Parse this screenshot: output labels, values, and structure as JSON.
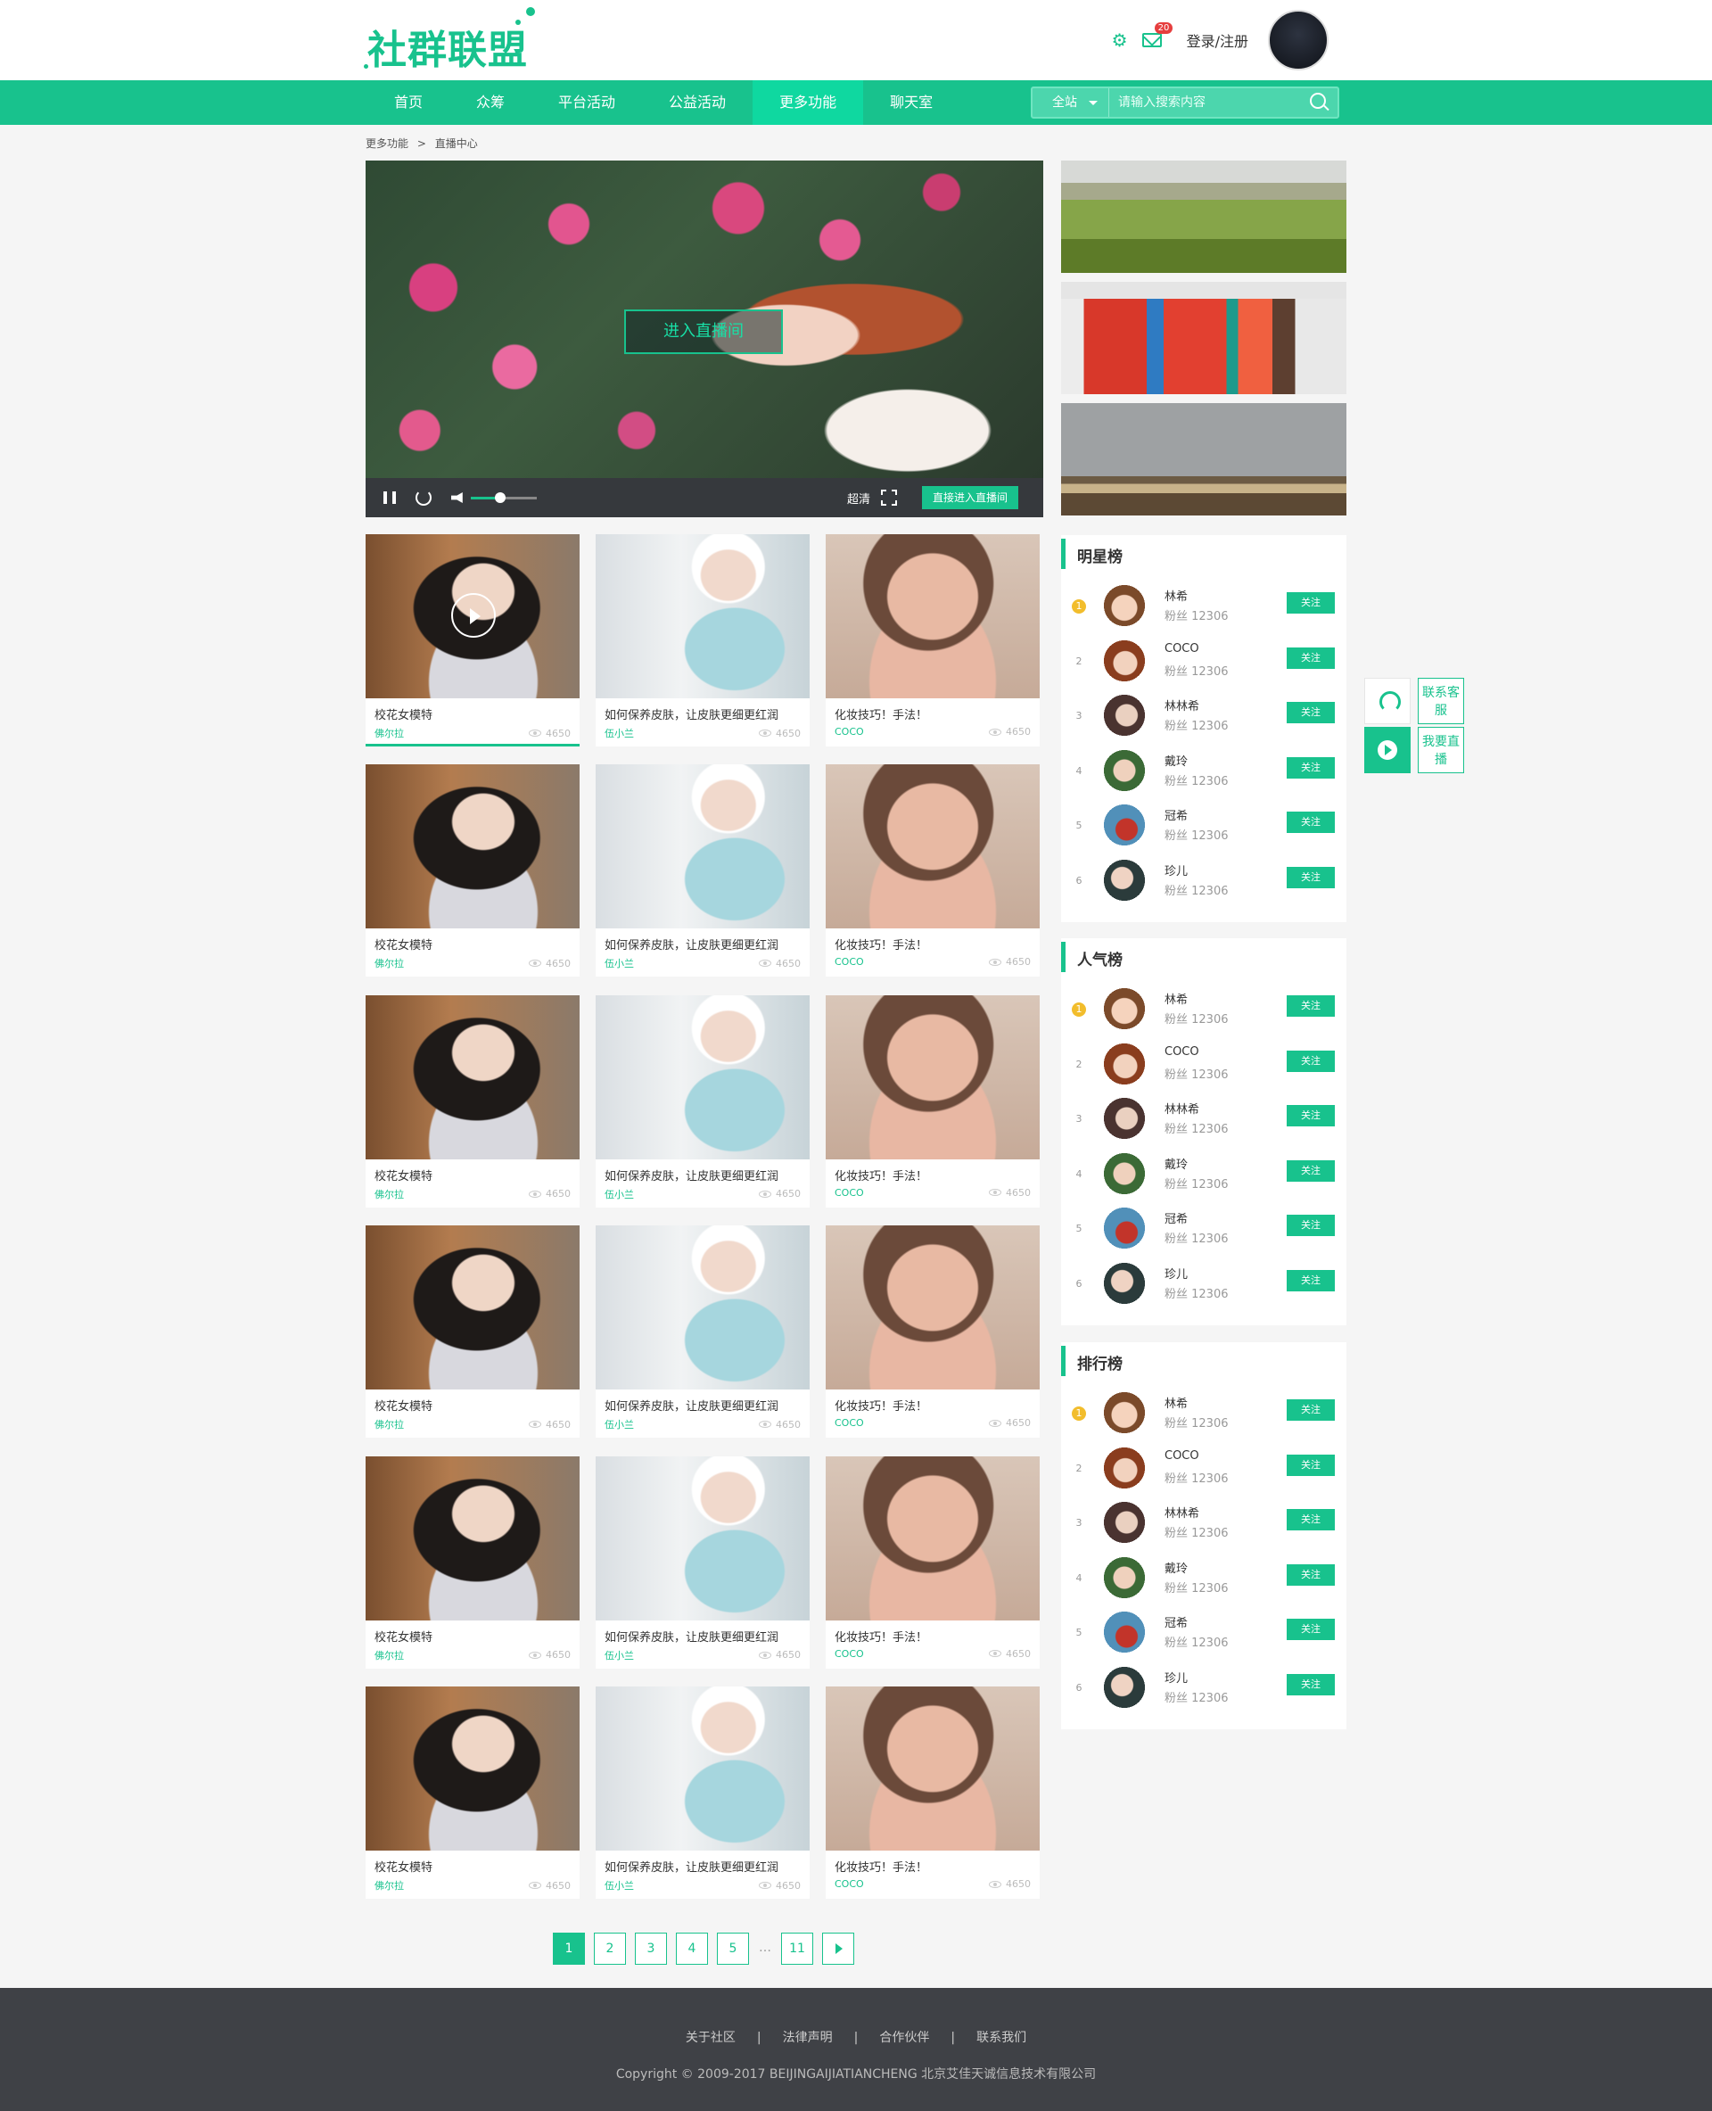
{
  "header": {
    "logo": "社群联盟",
    "mail_badge": "20",
    "login_label": "登录/注册",
    "icons": [
      "gear-icon",
      "mail-icon",
      "user-avatar"
    ]
  },
  "nav": {
    "items": [
      "首页",
      "众筹",
      "平台活动",
      "公益活动",
      "更多功能",
      "聊天室"
    ],
    "active": "更多功能",
    "search_scope": "全站",
    "search_placeholder": "请输入搜索内容"
  },
  "breadcrumb": [
    "更多功能",
    ">",
    "直播中心"
  ],
  "player": {
    "enter_button": "进入直播间",
    "quality": "超清",
    "live_button": "直接进入直播间",
    "volume": 0.45
  },
  "videos": [
    {
      "title": "校花女模特",
      "author": "佛尔拉",
      "views": "4650"
    },
    {
      "title": "如何保养皮肤，让皮肤更细更红润",
      "author": "伍小兰",
      "views": "4650"
    },
    {
      "title": "化妆技巧！手法！",
      "author": "COCO",
      "views": "4650"
    }
  ],
  "rankings": [
    {
      "title": "明星榜"
    },
    {
      "title": "人气榜"
    },
    {
      "title": "排行榜"
    }
  ],
  "rank_entries": [
    {
      "rank": "1",
      "name": "林希",
      "fans": "粉丝 12306",
      "follow": "关注"
    },
    {
      "rank": "2",
      "name": "COCO",
      "fans": "粉丝 12306",
      "follow": "关注"
    },
    {
      "rank": "3",
      "name": "林林希",
      "fans": "粉丝 12306",
      "follow": "关注"
    },
    {
      "rank": "4",
      "name": "戴玲",
      "fans": "粉丝 12306",
      "follow": "关注"
    },
    {
      "rank": "5",
      "name": "冠希",
      "fans": "粉丝 12306",
      "follow": "关注"
    },
    {
      "rank": "6",
      "name": "珍儿",
      "fans": "粉丝 12306",
      "follow": "关注"
    }
  ],
  "floating": {
    "contact": "联系客服",
    "live": "我要直播"
  },
  "pagination": [
    "1",
    "2",
    "3",
    "4",
    "5",
    "…",
    "11"
  ],
  "footer": {
    "links": [
      "关于社区",
      "|",
      "法律声明",
      "|",
      "合作伙伴",
      "|",
      "联系我们"
    ],
    "copyright": "Copyright © 2009-2017 BEIJINGAIJIATIANCHENG 北京艾佳天诚信息技术有限公司"
  },
  "colors": {
    "accent": "#18c28d",
    "active_nav": "#0fd8a0",
    "footer": "#3f4146"
  }
}
